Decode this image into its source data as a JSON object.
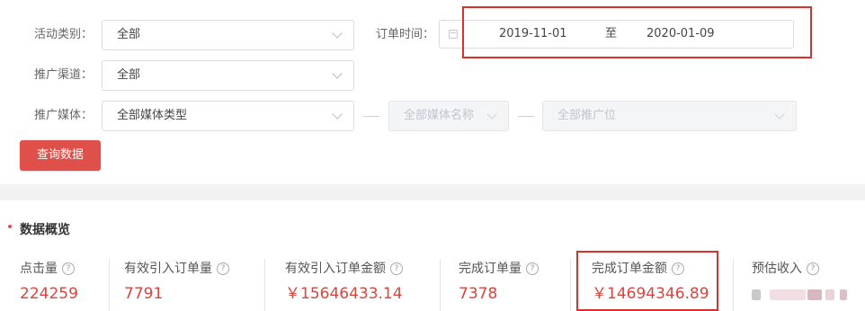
{
  "filters": {
    "activity_type": {
      "label": "活动类别：",
      "value": "全部"
    },
    "order_time": {
      "label": "订单时间：",
      "start": "2019-11-01",
      "separator": "至",
      "end": "2020-01-09"
    },
    "channel": {
      "label": "推广渠道：",
      "value": "全部"
    },
    "media": {
      "label": "推广媒体：",
      "type_value": "全部媒体类型",
      "name_placeholder": "全部媒体名称",
      "position_placeholder": "全部推广位"
    },
    "query_button": "查询数据"
  },
  "overview": {
    "title": "数据概览",
    "metrics": [
      {
        "label": "点击量",
        "value": "224259"
      },
      {
        "label": "有效引入订单量",
        "value": "7791"
      },
      {
        "label": "有效引入订单金额",
        "value": "￥15646433.14"
      },
      {
        "label": "完成订单量",
        "value": "7378"
      },
      {
        "label": "完成订单金额",
        "value": "￥14694346.89"
      },
      {
        "label": "预估收入",
        "value": ""
      }
    ],
    "help_glyph": "?"
  },
  "colors": {
    "accent": "#e0504a",
    "value_text": "#d6463f",
    "highlight_box": "#d9302c"
  },
  "icons": [
    "chevron-down-icon",
    "calendar-icon",
    "help-icon"
  ]
}
